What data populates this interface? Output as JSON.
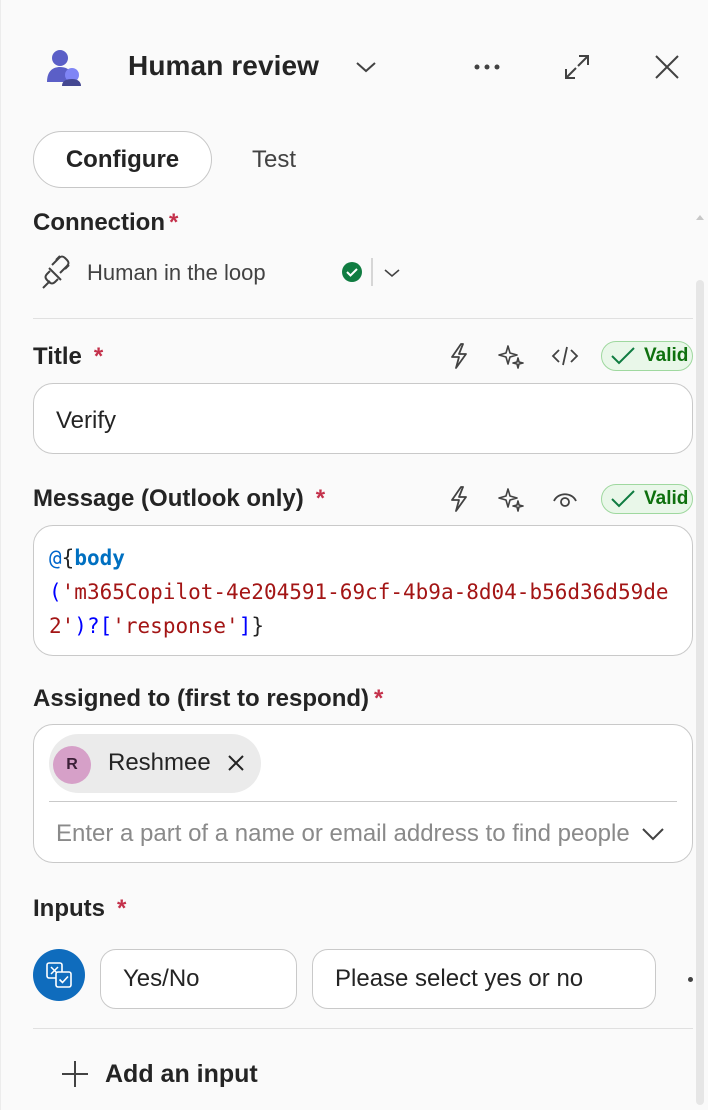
{
  "header": {
    "title": "Human review",
    "icons": {
      "app": "people-icon",
      "title_dropdown": "chevron-down-icon",
      "more": "more-horizontal-icon",
      "expand": "expand-icon",
      "close": "close-icon"
    }
  },
  "tabs": [
    {
      "label": "Configure",
      "selected": true
    },
    {
      "label": "Test",
      "selected": false
    }
  ],
  "connection": {
    "label": "Connection",
    "required_mark": "*",
    "name": "Human in the loop",
    "status_icon": "check-circle-icon",
    "status_color": "#107c41"
  },
  "title_field": {
    "label": "Title",
    "required_mark": "*",
    "value": "Verify",
    "icons": [
      "lightning-icon",
      "sparkle-icon",
      "code-icon"
    ],
    "status": "Valid"
  },
  "message_field": {
    "label": "Message (Outlook only)",
    "required_mark": "*",
    "icons": [
      "lightning-icon",
      "sparkle-icon",
      "eye-icon"
    ],
    "status": "Valid",
    "expression": {
      "at": "@",
      "open_brace": "{",
      "function": "body",
      "open_paren": "(",
      "argument": "'m365Copilot-4e204591-69cf-4b9a-8d04-b56d36d59de2'",
      "close_paren": ")",
      "accessor": "?[",
      "property": "'response'",
      "close_bracket": "]",
      "close_brace": "}"
    }
  },
  "assigned_field": {
    "label": "Assigned to (first to respond)",
    "required_mark": "*",
    "assignees": [
      {
        "initial": "R",
        "name": "Reshmee",
        "avatar_color": "#d6a0c8"
      }
    ],
    "search_placeholder": "Enter a part of a name or email address to find people"
  },
  "inputs_field": {
    "label": "Inputs",
    "required_mark": "*",
    "items": [
      {
        "type": "Yes/No",
        "prompt": "Please select yes or no",
        "icon": "yes-no-input-icon"
      }
    ],
    "add_label": "Add an input"
  },
  "colors": {
    "accent": "#0f6cbd",
    "required": "#c4314b",
    "valid_text": "#0e700e",
    "valid_bg": "#e9f7e9"
  }
}
